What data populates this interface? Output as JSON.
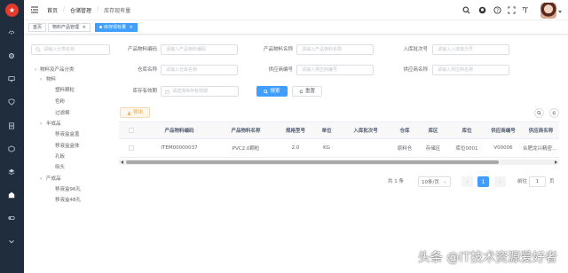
{
  "topbar": {
    "breadcrumb": [
      "首页",
      "仓储管理",
      "库存现有量"
    ]
  },
  "tags": {
    "home": "首页",
    "category": "物料产品管理",
    "current": "库存现有量"
  },
  "tree": {
    "search_placeholder": "请输入分类名称",
    "items": [
      {
        "label": "物料及产品分类",
        "level": 0
      },
      {
        "label": "物料",
        "level": 1
      },
      {
        "label": "塑料颗粒",
        "level": 2
      },
      {
        "label": "色粉",
        "level": 2
      },
      {
        "label": "过滤棉",
        "level": 2
      },
      {
        "label": "半成品",
        "level": 1
      },
      {
        "label": "移液盒盒盖",
        "level": 2
      },
      {
        "label": "移液盒盒体",
        "level": 2
      },
      {
        "label": "孔板",
        "level": 2
      },
      {
        "label": "吸头",
        "level": 2
      },
      {
        "label": "产成品",
        "level": 1
      },
      {
        "label": "移液盒96孔",
        "level": 2
      },
      {
        "label": "移液盒48孔",
        "level": 2
      }
    ]
  },
  "form": {
    "item_code_label": "产品物料编码",
    "item_code_placeholder": "请输入产品物料编码",
    "item_name_label": "产品物料名称",
    "item_name_placeholder": "请输入产品物料名称",
    "batch_label": "入库批次号",
    "batch_placeholder": "请输入入库批次号",
    "warehouse_label": "仓库名称",
    "warehouse_placeholder": "请输入仓库名称",
    "vendor_code_label": "供应商编号",
    "vendor_code_placeholder": "请输入供应商编号",
    "vendor_name_label": "供应商名称",
    "vendor_name_placeholder": "请输入供应商名称",
    "expire_label": "库存有效期",
    "expire_placeholder": "请选择库存有效期",
    "search_btn": "搜索",
    "reset_btn": "重置",
    "export_btn": "导出"
  },
  "table": {
    "columns": [
      "产品物料编码",
      "产品物料名称",
      "规格型号",
      "单位",
      "入库批次号",
      "仓库",
      "库区",
      "库位",
      "供应商编号",
      "供应商名称"
    ],
    "rows": [
      [
        "ITEM00000037",
        "PVC2.0颗粒",
        "2.0",
        "KG",
        "",
        "原料仓",
        "存储区",
        "库位0001",
        "V00006",
        "合肥龙兴精密..."
      ]
    ]
  },
  "pagination": {
    "total_text": "共 1 条",
    "page_size": "10条/页",
    "current_page": "1",
    "goto_label": "前往",
    "goto_value": "1",
    "page_suffix": "页"
  },
  "watermark": "头条 @IT技术资源爱好者",
  "colors": {
    "sidebar": "#1f2d3d",
    "primary": "#409eff",
    "warning": "#e6a23c"
  }
}
